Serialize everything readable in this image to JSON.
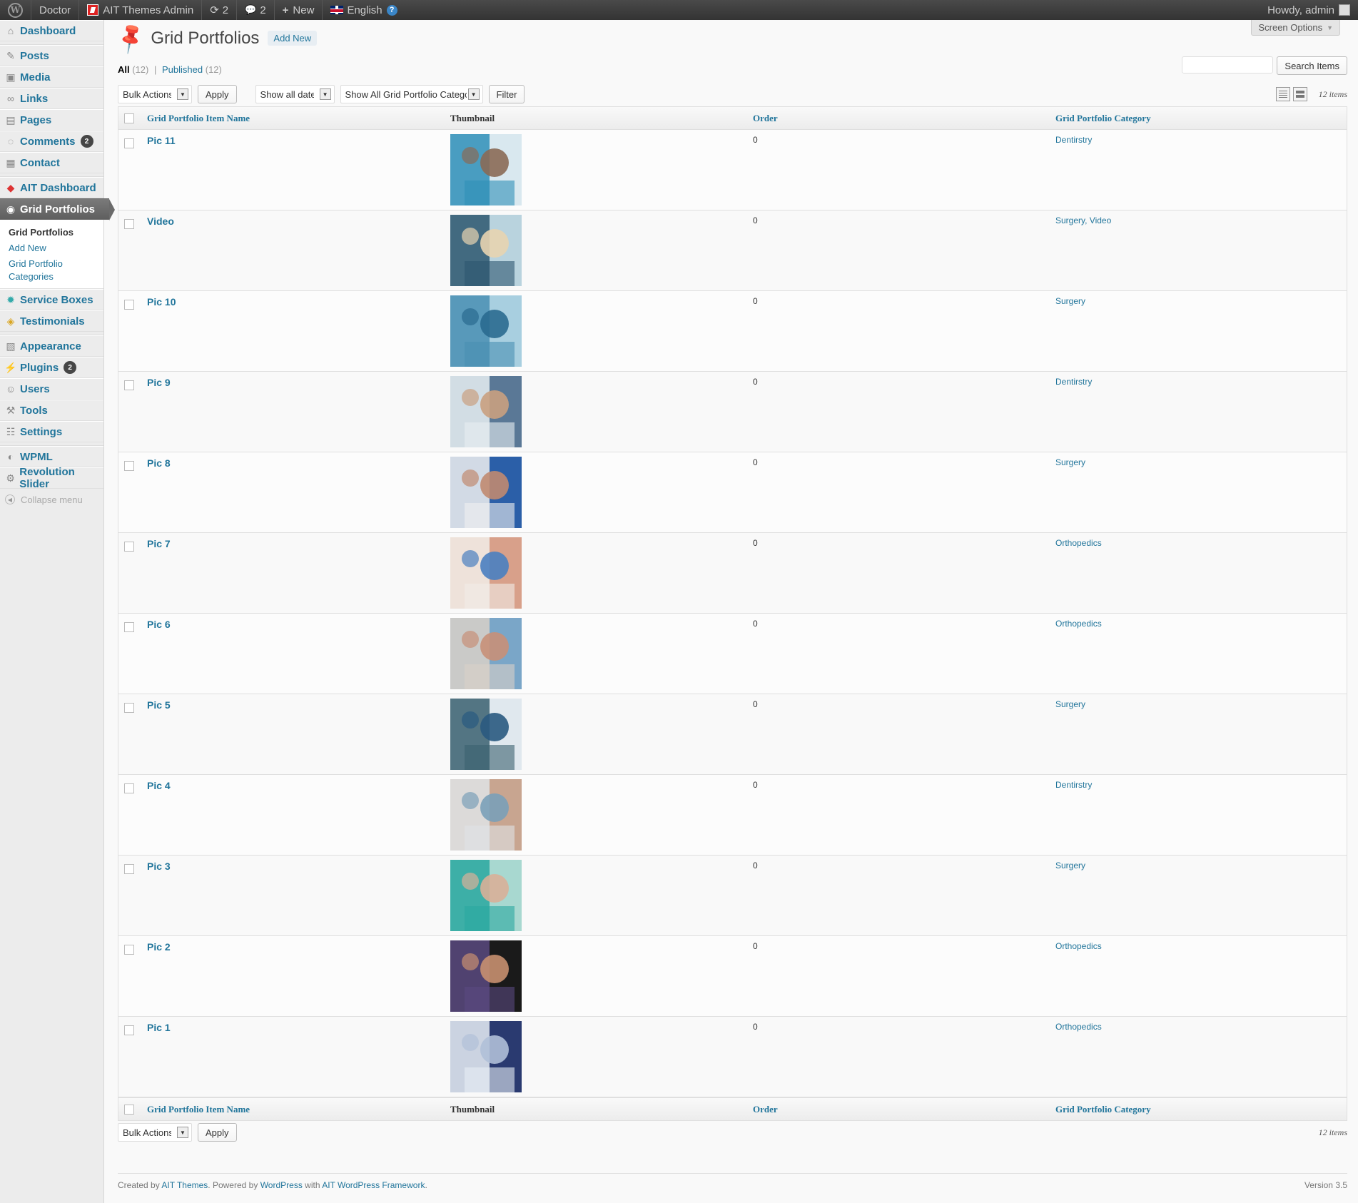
{
  "adminbar": {
    "site_name": "Doctor",
    "ait_admin": "AIT Themes Admin",
    "updates_count": "2",
    "comments_count": "2",
    "new_label": "New",
    "language": "English",
    "howdy": "Howdy, admin"
  },
  "sidebar": {
    "dashboard": "Dashboard",
    "posts": "Posts",
    "media": "Media",
    "links": "Links",
    "pages": "Pages",
    "comments": "Comments",
    "comments_badge": "2",
    "contact": "Contact",
    "ait_dashboard": "AIT Dashboard",
    "grid_portfolios": "Grid Portfolios",
    "sub_grid_portfolios": "Grid Portfolios",
    "sub_add_new": "Add New",
    "sub_categories": "Grid Portfolio Categories",
    "service_boxes": "Service Boxes",
    "testimonials": "Testimonials",
    "appearance": "Appearance",
    "plugins": "Plugins",
    "plugins_badge": "2",
    "users": "Users",
    "tools": "Tools",
    "settings": "Settings",
    "wpml": "WPML",
    "revolution_slider": "Revolution Slider",
    "collapse": "Collapse menu"
  },
  "header": {
    "screen_options": "Screen Options",
    "title": "Grid Portfolios",
    "add_new": "Add New",
    "filter_all": "All",
    "filter_all_count": "(12)",
    "filter_published": "Published",
    "filter_published_count": "(12)",
    "search_button": "Search Items"
  },
  "tablenav": {
    "bulk_actions": "Bulk Actions",
    "apply": "Apply",
    "dates": "Show all dates",
    "categories": "Show All Grid Portfolio Categories",
    "filter": "Filter",
    "items_count": "12 items"
  },
  "table": {
    "columns": [
      "Grid Portfolio Item Name",
      "Thumbnail",
      "Order",
      "Grid Portfolio Category"
    ],
    "rows": [
      {
        "name": "Pic 11",
        "order": "0",
        "category": "Dentirstry",
        "colors": [
          "#2f8fb8",
          "#d9e8ef",
          "#8a6a55"
        ]
      },
      {
        "name": "Video",
        "order": "0",
        "category": "Surgery, Video",
        "colors": [
          "#2d5770",
          "#b9d3de",
          "#e8d4b0"
        ]
      },
      {
        "name": "Pic 10",
        "order": "0",
        "category": "Surgery",
        "colors": [
          "#4a8fb3",
          "#a8cfe0",
          "#2a6a90"
        ]
      },
      {
        "name": "Pic 9",
        "order": "0",
        "category": "Dentirstry",
        "colors": [
          "#e8eef2",
          "#5a7896",
          "#c9a080"
        ]
      },
      {
        "name": "Pic 8",
        "order": "0",
        "category": "Surgery",
        "colors": [
          "#f0f0f0",
          "#2b5fa8",
          "#c08a70"
        ]
      },
      {
        "name": "Pic 7",
        "order": "0",
        "category": "Orthopedics",
        "colors": [
          "#f2ede8",
          "#d8a08a",
          "#4a80c0"
        ]
      },
      {
        "name": "Pic 6",
        "order": "0",
        "category": "Orthopedics",
        "colors": [
          "#d8d0c8",
          "#7aa6c8",
          "#c89078"
        ]
      },
      {
        "name": "Pic 5",
        "order": "0",
        "category": "Surgery",
        "colors": [
          "#3a6070",
          "#e0e8ee",
          "#2a5a80"
        ]
      },
      {
        "name": "Pic 4",
        "order": "0",
        "category": "Dentirstry",
        "colors": [
          "#dfe3e6",
          "#c8a590",
          "#7aa0b8"
        ]
      },
      {
        "name": "Pic 3",
        "order": "0",
        "category": "Surgery",
        "colors": [
          "#2aa8a0",
          "#a8d8d0",
          "#d8b098"
        ]
      },
      {
        "name": "Pic 2",
        "order": "0",
        "category": "Orthopedics",
        "colors": [
          "#5a4a80",
          "#1a1a1a",
          "#c89070"
        ]
      },
      {
        "name": "Pic 1",
        "order": "0",
        "category": "Orthopedics",
        "colors": [
          "#e8eef5",
          "#2a3a70",
          "#b0c0d8"
        ]
      }
    ]
  },
  "footer": {
    "created_by": "Created by",
    "ait_themes": "AIT Themes",
    "powered_by": ". Powered by",
    "wordpress": "WordPress",
    "with": "with",
    "framework": "AIT WordPress Framework",
    "period": ".",
    "version": "Version 3.5"
  }
}
